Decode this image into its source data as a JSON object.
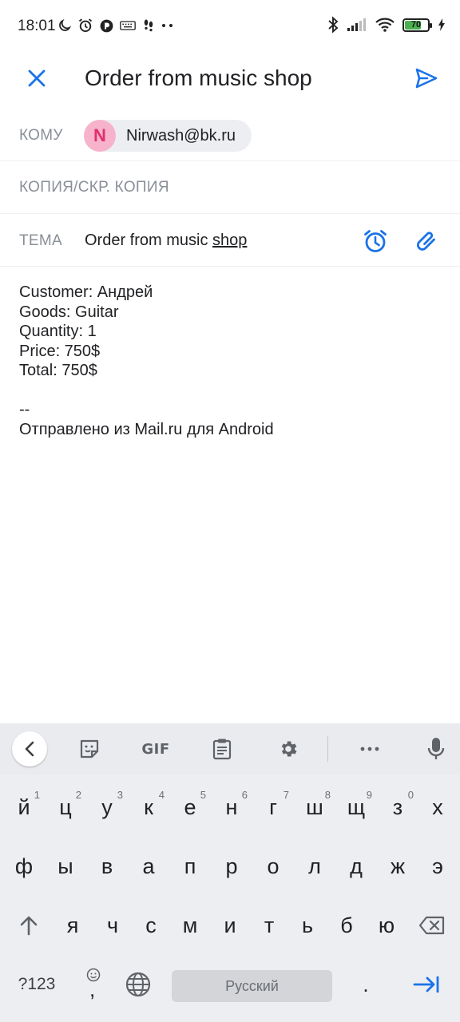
{
  "status_bar": {
    "time": "18:01",
    "battery_percent": "70",
    "icons_left": [
      "moon-icon",
      "alarm-icon",
      "app-notification-icon",
      "keyboard-icon",
      "footsteps-icon",
      "more-dots-icon"
    ],
    "icons_right": [
      "bluetooth-icon",
      "signal-icon",
      "wifi-icon",
      "battery-icon",
      "charging-icon"
    ]
  },
  "app_bar": {
    "title": "Order from music shop"
  },
  "fields": {
    "to_label": "КОМУ",
    "recipient_initial": "N",
    "recipient_email": "Nirwash@bk.ru",
    "cc_label": "КОПИЯ/СКР. КОПИЯ",
    "subject_label": "ТЕМА",
    "subject_value_plain": "Order from music ",
    "subject_value_underlined": "shop"
  },
  "body": {
    "lines": [
      "Customer: Андрей",
      "Goods: Guitar",
      "Quantity: 1",
      "Price: 750$",
      "Total: 750$",
      "",
      "--",
      "Отправлено из Mail.ru для Android"
    ]
  },
  "keyboard": {
    "toolbar": {
      "gif_label": "GIF"
    },
    "row1": [
      {
        "k": "й",
        "hint": "1"
      },
      {
        "k": "ц",
        "hint": "2"
      },
      {
        "k": "у",
        "hint": "3"
      },
      {
        "k": "к",
        "hint": "4"
      },
      {
        "k": "е",
        "hint": "5"
      },
      {
        "k": "н",
        "hint": "6"
      },
      {
        "k": "г",
        "hint": "7"
      },
      {
        "k": "ш",
        "hint": "8"
      },
      {
        "k": "щ",
        "hint": "9"
      },
      {
        "k": "з",
        "hint": "0"
      },
      {
        "k": "х",
        "hint": ""
      }
    ],
    "row2": [
      "ф",
      "ы",
      "в",
      "а",
      "п",
      "р",
      "о",
      "л",
      "д",
      "ж",
      "э"
    ],
    "row3": [
      "я",
      "ч",
      "с",
      "м",
      "и",
      "т",
      "ь",
      "б",
      "ю"
    ],
    "symbols_label": "?123",
    "comma_label": ",",
    "space_label": "Русский",
    "period_label": "."
  },
  "colors": {
    "accent": "#1a73e8",
    "avatar_bg": "#f6b3cb",
    "avatar_fg": "#e2306c"
  }
}
